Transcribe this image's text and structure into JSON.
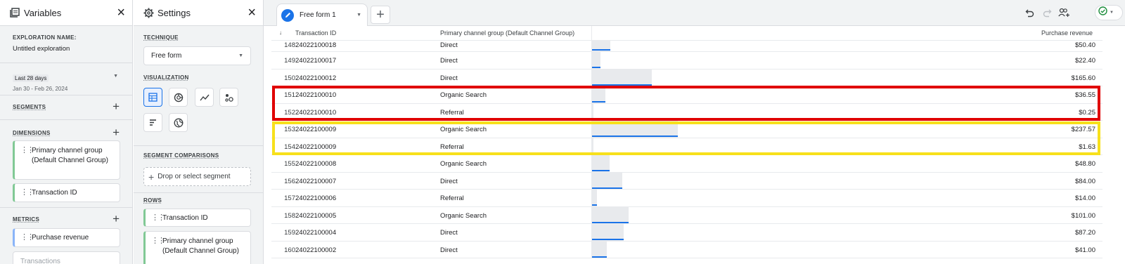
{
  "variables": {
    "title": "Variables",
    "exploration_name_label": "EXPLORATION NAME:",
    "exploration_name": "Untitled exploration",
    "date_chip": "Last 28 days",
    "date_range": "Jan 30 - Feb 26, 2024",
    "segments_label": "SEGMENTS",
    "dimensions_label": "DIMENSIONS",
    "dimensions": [
      "Primary channel group (Default Channel Group)",
      "Transaction ID"
    ],
    "metrics_label": "METRICS",
    "metrics": [
      "Purchase revenue",
      "Transactions"
    ]
  },
  "settings": {
    "title": "Settings",
    "technique_label": "TECHNIQUE",
    "technique_value": "Free form",
    "visualization_label": "VISUALIZATION",
    "visualizations": [
      "table-icon",
      "donut-chart-icon",
      "line-chart-icon",
      "scatter-plot-icon",
      "bar-chart-icon",
      "globe-icon"
    ],
    "segment_comparisons_label": "SEGMENT COMPARISONS",
    "segment_drop_label": "Drop or select segment",
    "rows_label": "ROWS",
    "rows": [
      "Transaction ID",
      "Primary channel group (Default Channel Group)"
    ]
  },
  "main": {
    "tab_label": "Free form 1",
    "columns": {
      "sort_indicator": "↓",
      "transaction_id": "Transaction ID",
      "channel": "Primary channel group (Default Channel Group)",
      "revenue": "Purchase revenue"
    },
    "rows": [
      {
        "idx": "148",
        "tx": "24022100018",
        "channel": "Direct",
        "revenue": "$50.40",
        "value": 50.4
      },
      {
        "idx": "149",
        "tx": "24022100017",
        "channel": "Direct",
        "revenue": "$22.40",
        "value": 22.4
      },
      {
        "idx": "150",
        "tx": "24022100012",
        "channel": "Direct",
        "revenue": "$165.60",
        "value": 165.6
      },
      {
        "idx": "151",
        "tx": "24022100010",
        "channel": "Organic Search",
        "revenue": "$36.55",
        "value": 36.55
      },
      {
        "idx": "152",
        "tx": "24022100010",
        "channel": "Referral",
        "revenue": "$0.25",
        "value": 0.25
      },
      {
        "idx": "153",
        "tx": "24022100009",
        "channel": "Organic Search",
        "revenue": "$237.57",
        "value": 237.57
      },
      {
        "idx": "154",
        "tx": "24022100009",
        "channel": "Referral",
        "revenue": "$1.63",
        "value": 1.63
      },
      {
        "idx": "155",
        "tx": "24022100008",
        "channel": "Organic Search",
        "revenue": "$48.80",
        "value": 48.8
      },
      {
        "idx": "156",
        "tx": "24022100007",
        "channel": "Direct",
        "revenue": "$84.00",
        "value": 84.0
      },
      {
        "idx": "157",
        "tx": "24022100006",
        "channel": "Referral",
        "revenue": "$14.00",
        "value": 14.0
      },
      {
        "idx": "158",
        "tx": "24022100005",
        "channel": "Organic Search",
        "revenue": "$101.00",
        "value": 101.0
      },
      {
        "idx": "159",
        "tx": "24022100004",
        "channel": "Direct",
        "revenue": "$87.20",
        "value": 87.2
      },
      {
        "idx": "160",
        "tx": "24022100002",
        "channel": "Direct",
        "revenue": "$41.00",
        "value": 41.0
      }
    ],
    "highlight_colors": {
      "red": "#e00000",
      "yellow": "#f7e01b"
    }
  }
}
